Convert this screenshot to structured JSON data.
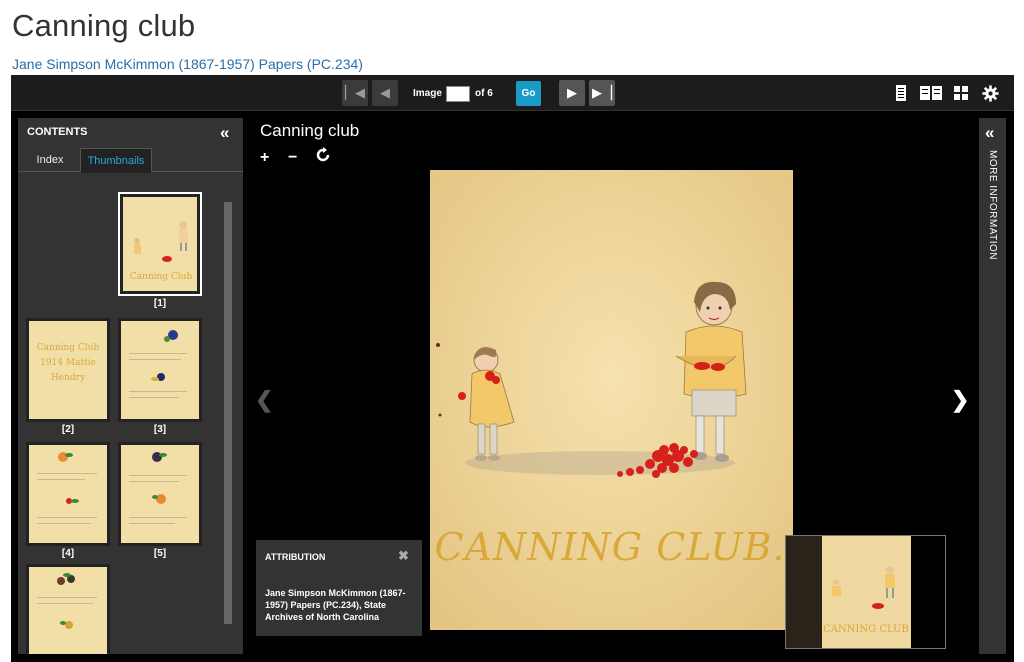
{
  "page": {
    "title": "Canning club",
    "collection_link": "Jane Simpson McKimmon (1867-1957) Papers (PC.234)"
  },
  "toolbar": {
    "image_label": "Image",
    "image_value": "",
    "of_label": "of 6",
    "go_label": "Go",
    "first_icon": "first-page-icon",
    "prev_icon": "prev-page-icon",
    "next_icon": "next-page-icon",
    "last_icon": "last-page-icon"
  },
  "contents": {
    "title": "CONTENTS",
    "collapse_glyph": "«",
    "tabs": [
      {
        "label": "Index",
        "active": false
      },
      {
        "label": "Thumbnails",
        "active": true
      }
    ],
    "thumbnails": [
      {
        "label": "[1]",
        "selected": true,
        "caption": "Canning Club"
      },
      {
        "label": "[2]",
        "selected": false,
        "caption": "Canning Club 1914 Mattie Hendry"
      },
      {
        "label": "[3]",
        "selected": false,
        "caption": ""
      },
      {
        "label": "[4]",
        "selected": false,
        "caption": ""
      },
      {
        "label": "[5]",
        "selected": false,
        "caption": ""
      },
      {
        "label": "",
        "selected": false,
        "caption": ""
      }
    ]
  },
  "image": {
    "title": "Canning club",
    "cover_text": "CANNING CLUB.",
    "zoom_in": "+",
    "zoom_out": "−",
    "rotate_icon": "rotate-icon"
  },
  "attribution": {
    "title": "ATTRIBUTION",
    "close": "✖",
    "text": "Jane Simpson McKimmon (1867-1957) Papers (PC.234), State Archives of North Carolina"
  },
  "navigator": {
    "cover_text": "CANNING CLUB"
  },
  "info_panel": {
    "collapse_glyph": "«",
    "label": "MORE INFORMATION"
  },
  "colors": {
    "accent": "#1a9bc7",
    "link": "#2a6fa8",
    "panel": "#333333",
    "paper": "#f0d9a0",
    "berries": "#d8201a",
    "lettering": "#d9a83a"
  }
}
